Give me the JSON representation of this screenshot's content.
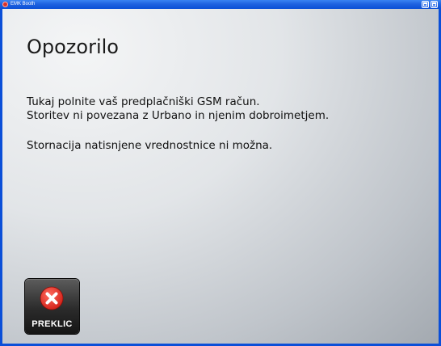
{
  "window": {
    "title": "EMK Booth"
  },
  "main": {
    "heading": "Opozorilo",
    "lines": [
      "Tukaj polnite vaš predplačniški GSM račun.",
      "Storitev ni povezana z Urbano in njenim dobroimetjem.",
      "Stornacija natisnjene vrednostnice ni možna."
    ]
  },
  "cancel_button": {
    "label": "PREKLIC",
    "icon": "close-circle-icon",
    "icon_color": "#e53935"
  },
  "colors": {
    "titlebar": "#1f63e0",
    "button_background": "#2b2b2b"
  }
}
